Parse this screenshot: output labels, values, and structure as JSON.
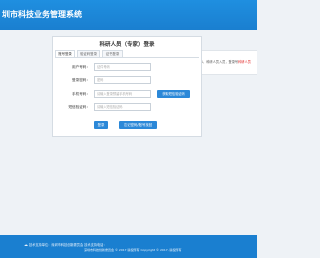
{
  "header": {
    "title": "圳市科技业务管理系统"
  },
  "login": {
    "title": "科研人员（专家）登录",
    "tabs": [
      "账号登录",
      "验证码登录",
      "证书登录"
    ],
    "fields": {
      "account": {
        "label": "用户号码：",
        "placeholder": "证件号码"
      },
      "password": {
        "label": "登录密码：",
        "placeholder": "密码"
      },
      "phone": {
        "label": "手机号码：",
        "placeholder": "请输入登录预留手机号码"
      },
      "sms_code": {
        "label": "短信验证码：",
        "placeholder": "请输入短信验证码"
      }
    },
    "send_code_label": "获取短信验证码",
    "login_label": "登录",
    "forgot_label": "忘记密码/账号找回"
  },
  "notice": {
    "prefix": "1、科研人员入员，登录号",
    "highlight": "科研人员"
  },
  "footer": {
    "line1": "技术支持单位：深圳市科技创新委员会  技术支持电话：",
    "line2": "深圳市科技创新委员会 © 2017 版权所有    Copyright © 2017, 版权所有"
  }
}
